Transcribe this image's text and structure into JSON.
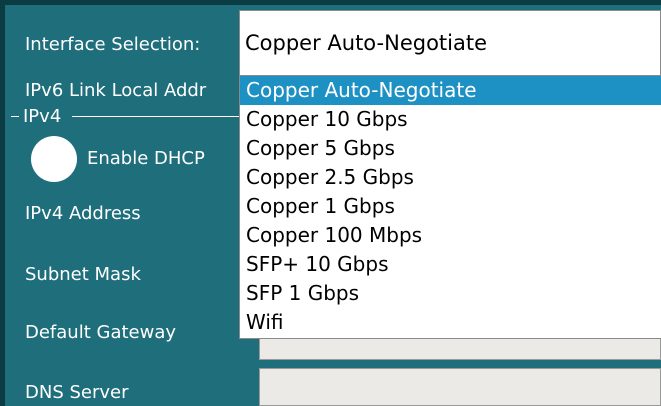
{
  "form": {
    "interface_selection_label": "Interface Selection:",
    "ipv6_label": "IPv6 Link Local Addr",
    "ipv4_section_title": "IPv4",
    "enable_dhcp_label": "Enable DHCP",
    "ipv4_address_label": "IPv4 Address",
    "subnet_mask_label": "Subnet Mask",
    "default_gateway_label": "Default Gateway",
    "dns_server_label": "DNS Server",
    "enable_dhcp_on": true
  },
  "interface_select": {
    "selected_value": "Copper Auto-Negotiate",
    "options": [
      "Copper Auto-Negotiate",
      "Copper 10 Gbps",
      "Copper 5 Gbps",
      "Copper 2.5 Gbps",
      "Copper 1 Gbps",
      "Copper 100 Mbps",
      "SFP+ 10 Gbps",
      "SFP 1 Gbps",
      "Wifi"
    ],
    "highlighted_index": 0
  },
  "colors": {
    "panel_bg": "#1f6e7c",
    "highlight": "#1e91c4",
    "field_bg": "#eceae6"
  }
}
